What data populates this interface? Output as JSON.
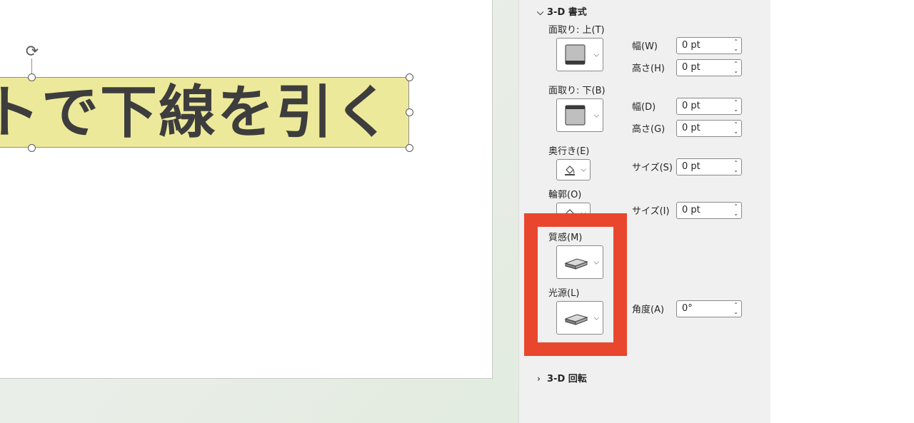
{
  "slide": {
    "textbox_text": "トで下線を引く",
    "textbox_color": "#ede99b"
  },
  "pane": {
    "section_3d_format": {
      "title": "3-D 書式",
      "expanded": true
    },
    "bevel_top": {
      "label": "面取り: 上(T)",
      "width_label": "幅(W)",
      "width_value": "0 pt",
      "height_label": "高さ(H)",
      "height_value": "0 pt"
    },
    "bevel_bottom": {
      "label": "面取り: 下(B)",
      "width_label": "幅(D)",
      "width_value": "0 pt",
      "height_label": "高さ(G)",
      "height_value": "0 pt"
    },
    "depth": {
      "label": "奥行き(E)",
      "size_label": "サイズ(S)",
      "size_value": "0 pt"
    },
    "contour": {
      "label": "輪郭(O)",
      "size_label": "サイズ(I)",
      "size_value": "0 pt"
    },
    "material": {
      "label": "質感(M)"
    },
    "lighting": {
      "label": "光源(L)",
      "angle_label": "角度(A)",
      "angle_value": "0°"
    },
    "section_3d_rotation": {
      "title": "3-D 回転",
      "expanded": false
    }
  },
  "highlight_color": "#e8472e",
  "icons": {
    "expand": "chevron-down-icon",
    "collapse": "chevron-right-icon",
    "rotate": "rotate-icon",
    "dropdown": "chevron-down-icon",
    "bevel": "bevel-preset-icon",
    "fill": "paint-bucket-icon",
    "material": "material-preset-icon",
    "lighting": "lighting-preset-icon"
  }
}
